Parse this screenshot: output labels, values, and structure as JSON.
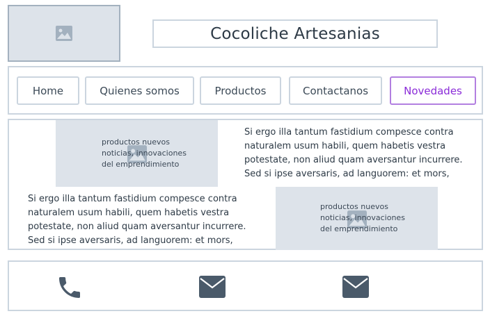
{
  "header": {
    "logo_icon": "image-placeholder-icon",
    "title": "Cocoliche Artesanias"
  },
  "nav": {
    "items": [
      {
        "label": "Home",
        "active": false
      },
      {
        "label": "Quienes somos",
        "active": false
      },
      {
        "label": "Productos",
        "active": false
      },
      {
        "label": "Contactanos",
        "active": false
      },
      {
        "label": "Novedades",
        "active": true
      }
    ],
    "active_color": "#8a2bd8"
  },
  "content": {
    "block1": {
      "image_caption": "productos nuevos\nnoticias, innovaciones\ndel emprendimiento",
      "paragraph": "Si ergo illa tantum fastidium compesce contra naturalem usum habili, quem habetis vestra potestate, non aliud quam aversantur incurrere. Sed si ipse aversaris, ad languorem: et mors,"
    },
    "block2": {
      "image_caption": "productos nuevos\nnoticias, innovaciones\ndel emprendimiento",
      "paragraph": "Si ergo illa tantum fastidium compesce contra naturalem usum habili, quem habetis vestra potestate, non aliud quam aversantur incurrere. Sed si ipse aversaris, ad languorem: et mors,"
    }
  },
  "footer": {
    "icons": [
      "phone-icon",
      "mail-icon",
      "mail-icon"
    ],
    "icon_color": "#4a5a6a"
  }
}
